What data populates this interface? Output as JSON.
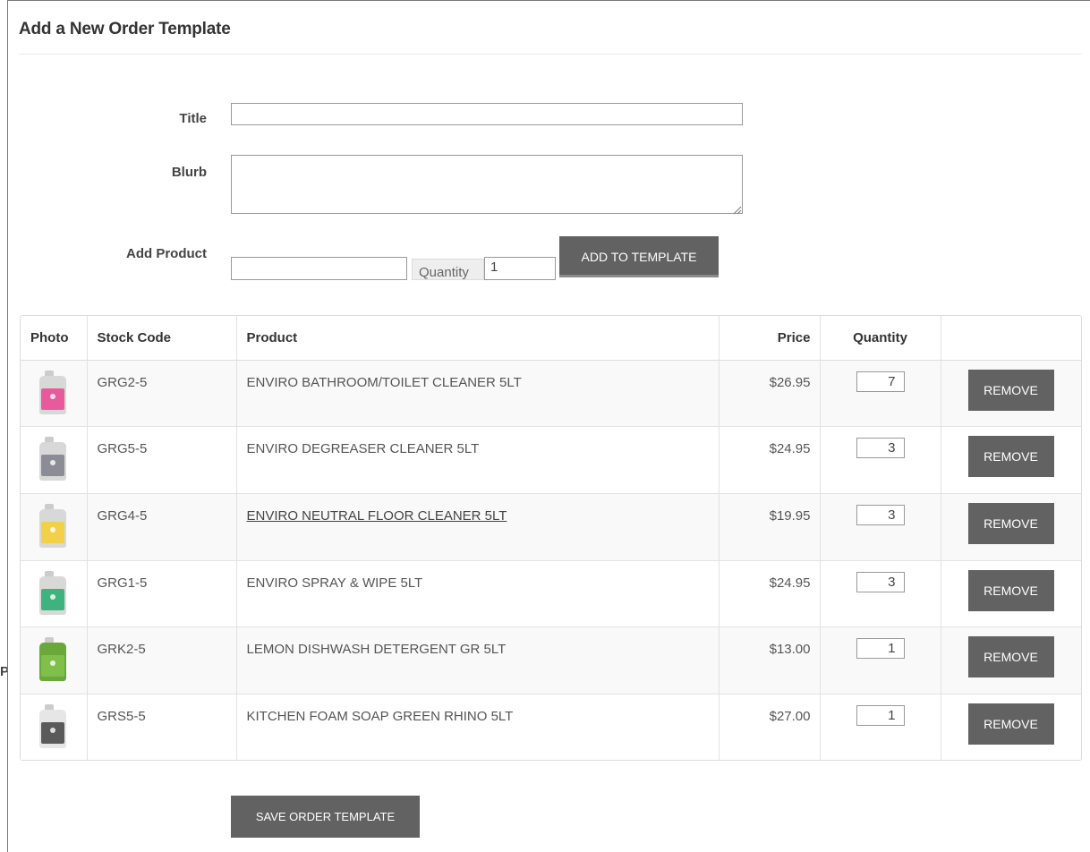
{
  "header": {
    "title": "Add a New Order Template"
  },
  "form": {
    "title_label": "Title",
    "title_value": "",
    "blurb_label": "Blurb",
    "blurb_value": "",
    "add_product_label": "Add Product",
    "add_product_value": "",
    "quantity_label": "Quantity",
    "quantity_value": "1",
    "add_button": "ADD TO TEMPLATE"
  },
  "table": {
    "columns": [
      "Photo",
      "Stock Code",
      "Product",
      "Price",
      "Quantity",
      ""
    ],
    "rows": [
      {
        "stock_code": "GRG2-5",
        "product": "ENVIRO BATHROOM/TOILET CLEANER 5LT",
        "price": "$26.95",
        "quantity": "7",
        "remove": "REMOVE",
        "photo_icon": "pink-cleaner-jug-icon",
        "label_color": "#e75a9c"
      },
      {
        "stock_code": "GRG5-5",
        "product": "ENVIRO DEGREASER CLEANER 5LT",
        "price": "$24.95",
        "quantity": "3",
        "remove": "REMOVE",
        "photo_icon": "grey-degreaser-jug-icon",
        "label_color": "#8c8c96"
      },
      {
        "stock_code": "GRG4-5",
        "product": "ENVIRO NEUTRAL FLOOR CLEANER 5LT",
        "price": "$19.95",
        "quantity": "3",
        "remove": "REMOVE",
        "photo_icon": "yellow-floor-cleaner-jug-icon",
        "label_color": "#f2d04a"
      },
      {
        "stock_code": "GRG1-5",
        "product": "ENVIRO SPRAY & WIPE 5LT",
        "price": "$24.95",
        "quantity": "3",
        "remove": "REMOVE",
        "photo_icon": "green-spray-wipe-jug-icon",
        "label_color": "#3fb27f"
      },
      {
        "stock_code": "GRK2-5",
        "product": "LEMON DISHWASH DETERGENT GR 5LT",
        "price": "$13.00",
        "quantity": "1",
        "remove": "REMOVE",
        "photo_icon": "lime-dishwash-jug-icon",
        "label_color": "#7fbf4a"
      },
      {
        "stock_code": "GRS5-5",
        "product": "KITCHEN FOAM SOAP GREEN RHINO 5LT",
        "price": "$27.00",
        "quantity": "1",
        "remove": "REMOVE",
        "photo_icon": "white-foam-soap-jug-icon",
        "label_color": "#5a5a5a"
      }
    ]
  },
  "save_button": "SAVE ORDER TEMPLATE",
  "stray_text": "P",
  "colors": {
    "button_bg": "#626262",
    "row_alt": "#f9f9f9"
  }
}
